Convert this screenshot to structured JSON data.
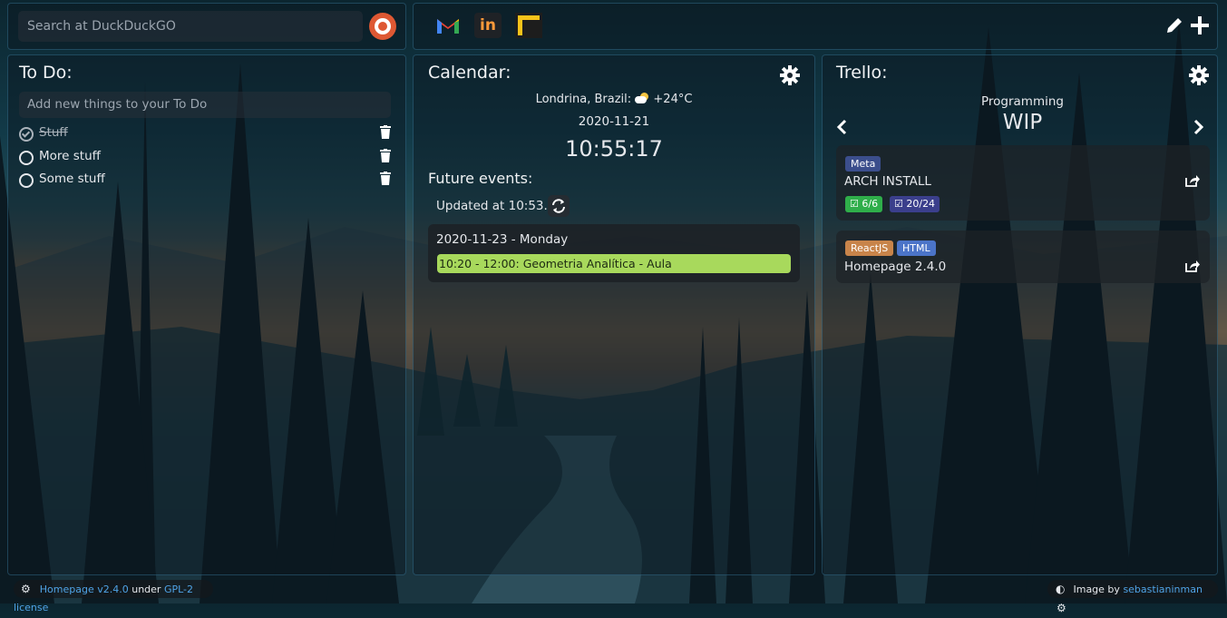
{
  "search": {
    "placeholder": "Search at DuckDuckGO"
  },
  "bookmarks": [
    {
      "icon": "gmail-icon"
    },
    {
      "icon": "in-icon"
    },
    {
      "icon": "yellow-square-icon"
    }
  ],
  "toolbar": {
    "edit_icon": "pencil-icon",
    "add_icon": "plus-icon"
  },
  "todo": {
    "title": "To Do:",
    "input_placeholder": "Add new things to your To Do",
    "items": [
      {
        "label": "Stuff",
        "done": true
      },
      {
        "label": "More stuff",
        "done": false
      },
      {
        "label": "Some stuff",
        "done": false
      }
    ]
  },
  "calendar": {
    "title": "Calendar:",
    "location": "Londrina, Brazil:",
    "temperature": "+24°C",
    "weather_icon": "partly-cloudy-icon",
    "date": "2020-11-21",
    "time": "10:55:17",
    "future_title": "Future events:",
    "updated": "Updated at 10:53.",
    "day_header": "2020-11-23 - Monday",
    "event": "10:20 - 12:00: Geometria Analítica - Aula",
    "event_color": "#a8d95c"
  },
  "trello": {
    "title": "Trello:",
    "board": "Programming",
    "list": "WIP",
    "cards": [
      {
        "tags": [
          {
            "label": "Meta",
            "color": "#3b4e8c"
          }
        ],
        "title": "ARCH INSTALL",
        "checklists": [
          {
            "label": "6/6",
            "color": "#2fae4a"
          },
          {
            "label": "20/24",
            "color": "#3b3f8c"
          }
        ]
      },
      {
        "tags": [
          {
            "label": "ReactJS",
            "color": "#c8844a"
          },
          {
            "label": "HTML",
            "color": "#4b74c8"
          }
        ],
        "title": "Homepage 2.4.0",
        "checklists": []
      }
    ]
  },
  "footer": {
    "left_link": "Homepage v2.4.0",
    "left_mid": "under",
    "left_license": "GPL-2 license",
    "right_text": "Image by",
    "right_link": "sebastianinman"
  }
}
